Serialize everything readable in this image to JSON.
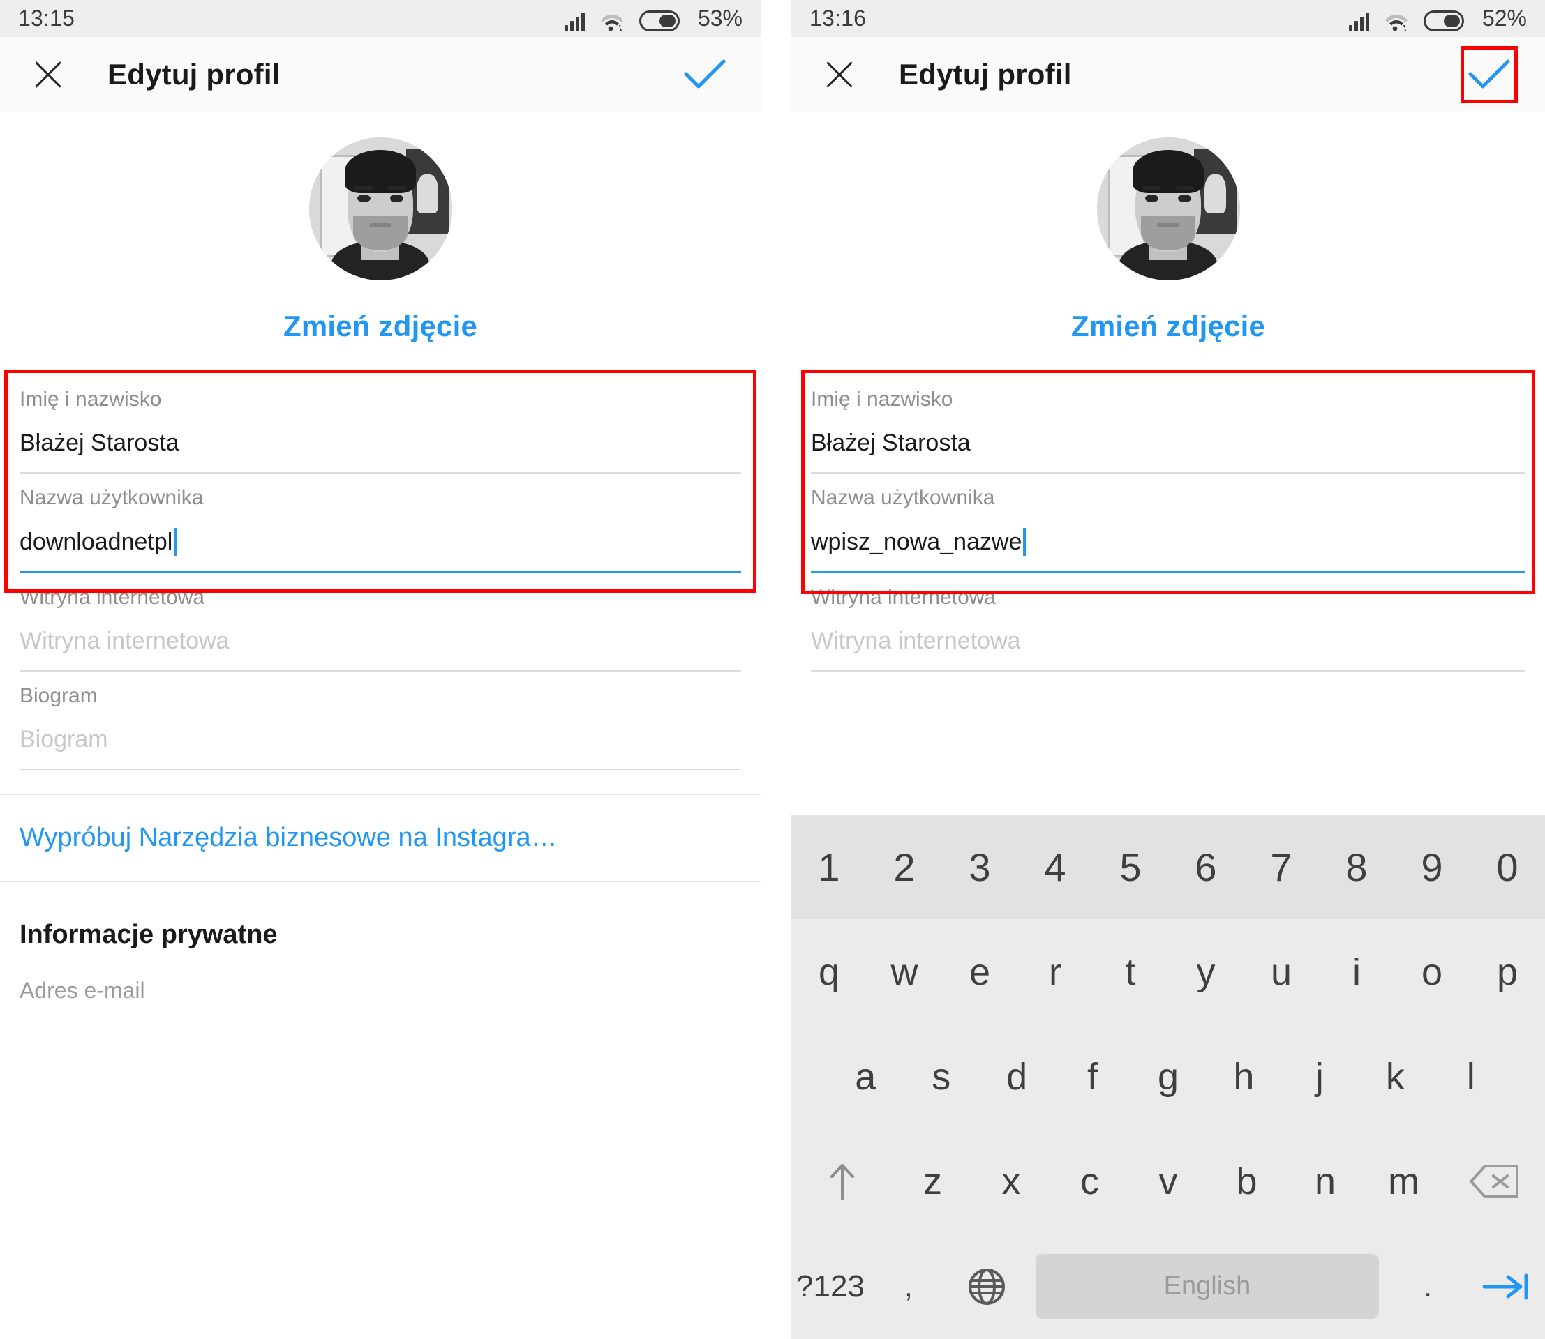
{
  "panels": [
    {
      "id": "before",
      "status": {
        "time": "13:15",
        "battery_pct": "53%",
        "signal_icon": "signal-bars-icon",
        "wifi_icon": "wifi-icon",
        "battery_icon": "battery-icon"
      },
      "appbar": {
        "close_icon": "close-icon",
        "title": "Edytuj profil",
        "confirm_icon": "check-icon",
        "confirm_highlighted": false
      },
      "profile": {
        "avatar": "profile-avatar",
        "change_photo": "Zmień zdjęcie"
      },
      "fields": [
        {
          "label": "Imię i nazwisko",
          "value": "Błażej Starosta",
          "placeholder": "",
          "focused": false,
          "is_placeholder": false
        },
        {
          "label": "Nazwa użytkownika",
          "value": "downloadnetpl",
          "placeholder": "",
          "focused": true,
          "is_placeholder": false
        },
        {
          "label": "Witryna internetowa",
          "value": "Witryna internetowa",
          "placeholder": "Witryna internetowa",
          "focused": false,
          "is_placeholder": true
        },
        {
          "label": "Biogram",
          "value": "Biogram",
          "placeholder": "Biogram",
          "focused": false,
          "is_placeholder": true
        }
      ],
      "business_link": "Wypróbuj Narzędzia biznesowe na Instagra…",
      "section_title": "Informacje prywatne",
      "email_label": "Adres e-mail",
      "keyboard_visible": false
    },
    {
      "id": "after",
      "status": {
        "time": "13:16",
        "battery_pct": "52%",
        "signal_icon": "signal-bars-icon",
        "wifi_icon": "wifi-icon",
        "battery_icon": "battery-icon"
      },
      "appbar": {
        "close_icon": "close-icon",
        "title": "Edytuj profil",
        "confirm_icon": "check-icon",
        "confirm_highlighted": true
      },
      "profile": {
        "avatar": "profile-avatar",
        "change_photo": "Zmień zdjęcie"
      },
      "fields": [
        {
          "label": "Imię i nazwisko",
          "value": "Błażej Starosta",
          "placeholder": "",
          "focused": false,
          "is_placeholder": false
        },
        {
          "label": "Nazwa użytkownika",
          "value": "wpisz_nowa_nazwe",
          "placeholder": "",
          "focused": true,
          "is_placeholder": false
        },
        {
          "label": "Witryna internetowa",
          "value": "",
          "placeholder": "Witryna internetowa",
          "focused": false,
          "is_placeholder": true
        }
      ],
      "keyboard_visible": true
    }
  ],
  "keyboard": {
    "rows": {
      "numbers": [
        "1",
        "2",
        "3",
        "4",
        "5",
        "6",
        "7",
        "8",
        "9",
        "0"
      ],
      "qwerty": [
        "q",
        "w",
        "e",
        "r",
        "t",
        "y",
        "u",
        "i",
        "o",
        "p"
      ],
      "asdf": [
        "a",
        "s",
        "d",
        "f",
        "g",
        "h",
        "j",
        "k",
        "l"
      ],
      "zxcv": [
        "z",
        "x",
        "c",
        "v",
        "b",
        "n",
        "m"
      ]
    },
    "shift_icon": "shift-arrow-up-icon",
    "backspace_icon": "backspace-icon",
    "symbols_key": "?123",
    "comma_key": ",",
    "globe_icon": "globe-language-icon",
    "space_key": "English",
    "period_key": ".",
    "enter_icon": "enter-next-icon"
  },
  "colors": {
    "accent_blue": "#2196f3",
    "highlight_red": "#ff0000",
    "label_grey": "#8e8e8e",
    "placeholder_grey": "#c7c7c7",
    "keyboard_bg": "#ebebeb",
    "keyboard_num_bg": "#e2e2e2",
    "statusbar_bg": "#eeeeee"
  }
}
